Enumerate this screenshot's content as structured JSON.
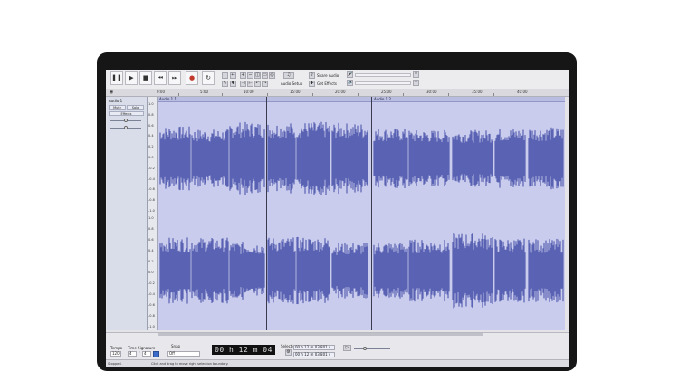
{
  "toolbar": {
    "pause_icon": "pause-icon",
    "play_icon": "play-icon",
    "stop_icon": "stop-icon",
    "skip_start_icon": "skip-start-icon",
    "skip_end_icon": "skip-end-icon",
    "record_icon": "record-icon",
    "loop_icon": "loop-icon",
    "audio_setup_label": "Audio Setup",
    "share_audio_label": "Share Audio",
    "get_effects_label": "Get Effects"
  },
  "ruler": {
    "ticks": [
      "0:00",
      "5:00",
      "10:00",
      "15:00",
      "20:00",
      "25:00",
      "30:00",
      "35:00",
      "40:00"
    ]
  },
  "track": {
    "name": "Audio 1",
    "mute_label": "Mute",
    "solo_label": "Solo",
    "effects_label": "Effects",
    "clips": [
      {
        "name": "Audio 1.1"
      },
      {
        "name": "Audio 1.2"
      }
    ],
    "scale_top": [
      "1.0",
      "0.9",
      "0.8",
      "0.7",
      "0.6",
      "0.5",
      "0.4",
      "0.3",
      "0.2",
      "0.1",
      "0.0",
      "-0.1",
      "-0.2",
      "-0.3",
      "-0.4",
      "-0.5",
      "-0.6",
      "-0.7",
      "-0.8",
      "-0.9",
      "-1.0"
    ],
    "scale_bottom": [
      "1.0",
      "0.9",
      "0.8",
      "0.7",
      "0.6",
      "0.5",
      "0.4",
      "0.3",
      "0.2",
      "0.1",
      "0.0",
      "-0.1",
      "-0.2",
      "-0.3",
      "-0.4",
      "-0.5",
      "-0.6",
      "-0.7",
      "-0.8",
      "-0.9",
      "-1.0"
    ]
  },
  "bottom": {
    "tempo_label": "Tempo",
    "tempo_value": "120",
    "time_signature_label": "Time Signature",
    "time_sig_num": "4",
    "time_sig_den": "4",
    "snap_label": "Snap",
    "snap_value": "Off",
    "time_display": "00 h 12 m 04 s",
    "selection_label": "Selection",
    "selection_start": "00 h 12 m 03.801 s",
    "selection_end": "00 h 12 m 03.801 s"
  },
  "status": {
    "state": "Stopped.",
    "hint": "Click and drag to move right selection boundary."
  },
  "colors": {
    "waveform": "#5a62b4",
    "background": "#c9ccec"
  }
}
